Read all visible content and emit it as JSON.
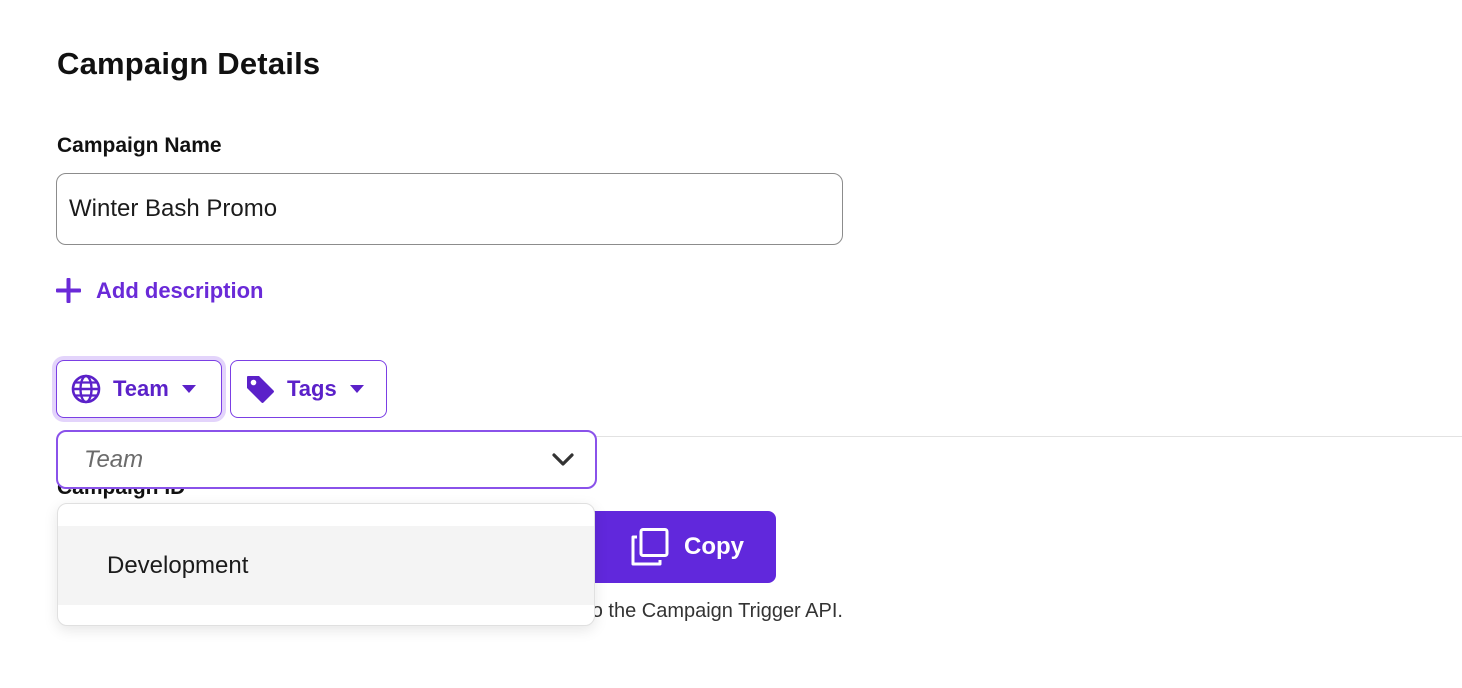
{
  "page": {
    "title": "Campaign Details"
  },
  "campaign_name": {
    "label": "Campaign Name",
    "value": "Winter Bash Promo"
  },
  "add_description": {
    "label": "Add description"
  },
  "filters": {
    "team_label": "Team",
    "tags_label": "Tags"
  },
  "team_select": {
    "placeholder": "Team",
    "options": [
      "Development"
    ]
  },
  "campaign_id": {
    "label": "Campaign ID",
    "copy_label": "Copy",
    "helper_text": "Use this ID to identify which Campaign to send in a request to the Campaign Trigger API."
  },
  "colors": {
    "accent": "#6128dc",
    "accent_text": "#5b21c9",
    "focus_ring": "#e3d4fb"
  },
  "icons": {
    "add": "plus-icon",
    "team": "globe-icon",
    "tags": "tag-icon",
    "caret": "caret-down-icon",
    "select": "chevron-down-icon",
    "copy": "copy-icon"
  }
}
